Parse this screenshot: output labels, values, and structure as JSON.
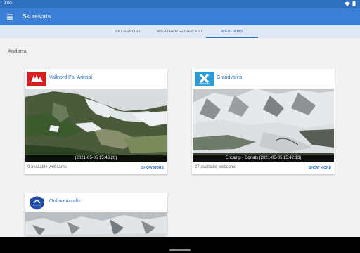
{
  "status": {
    "time": "9:00",
    "icons": [
      "wifi-icon",
      "battery-icon"
    ]
  },
  "app": {
    "title": "Ski resorts",
    "menu_icon": "menu-icon"
  },
  "tabs": [
    {
      "label": "SKI REPORT",
      "active": false
    },
    {
      "label": "WEATHER FORECAST",
      "active": false
    },
    {
      "label": "WEBCAMS",
      "active": true
    }
  ],
  "region": "Andorra",
  "resorts": [
    {
      "name": "Vallnord Pal-Arinsal",
      "caption": "(2021-05-05 15:43:20)",
      "count": "9 available webcams",
      "more": "SHOW MORE",
      "logo": "vallnord-logo",
      "logo_color": "#d71d1d"
    },
    {
      "name": "Grandvalira",
      "caption": "Encamp - Cortals (2021-05-05 15:42:13)",
      "count": "27 available webcams",
      "more": "SHOW MORE",
      "logo": "grandvalira-logo",
      "logo_color": "#2b9bd6"
    },
    {
      "name": "Ordino-Arcalís",
      "caption": "",
      "count": "",
      "more": "",
      "logo": "ordino-arcalis-logo",
      "logo_color": "#1f4fa8"
    }
  ],
  "colors": {
    "primary": "#3a7fd5",
    "status": "#2e6fbe",
    "accent": "#2a6fc6",
    "tabs_bg": "#dfe8f4"
  }
}
